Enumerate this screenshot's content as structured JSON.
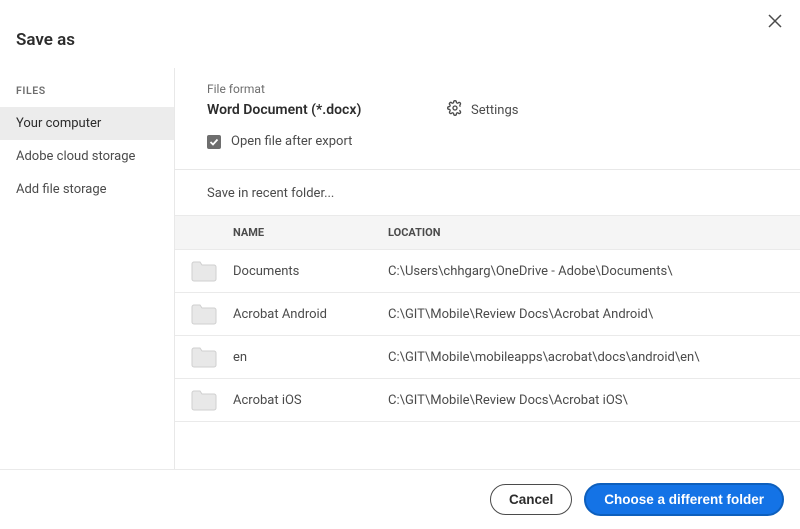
{
  "dialog": {
    "title": "Save as"
  },
  "sidebar": {
    "header": "FILES",
    "items": [
      {
        "label": "Your computer",
        "active": true
      },
      {
        "label": "Adobe cloud storage",
        "active": false
      },
      {
        "label": "Add file storage",
        "active": false
      }
    ]
  },
  "file_format": {
    "label": "File format",
    "value": "Word Document (*.docx)",
    "settings_label": "Settings",
    "open_after_export_label": "Open file after export",
    "open_after_export_checked": true
  },
  "recent": {
    "label": "Save in recent folder...",
    "columns": {
      "name": "NAME",
      "location": "Location"
    },
    "folders": [
      {
        "name": "Documents",
        "location": "C:\\Users\\chhgarg\\OneDrive - Adobe\\Documents\\"
      },
      {
        "name": "Acrobat Android",
        "location": "C:\\GIT\\Mobile\\Review Docs\\Acrobat Android\\"
      },
      {
        "name": "en",
        "location": "C:\\GIT\\Mobile\\mobileapps\\acrobat\\docs\\android\\en\\"
      },
      {
        "name": "Acrobat iOS",
        "location": "C:\\GIT\\Mobile\\Review Docs\\Acrobat iOS\\"
      }
    ]
  },
  "footer": {
    "cancel": "Cancel",
    "choose": "Choose a different folder"
  }
}
